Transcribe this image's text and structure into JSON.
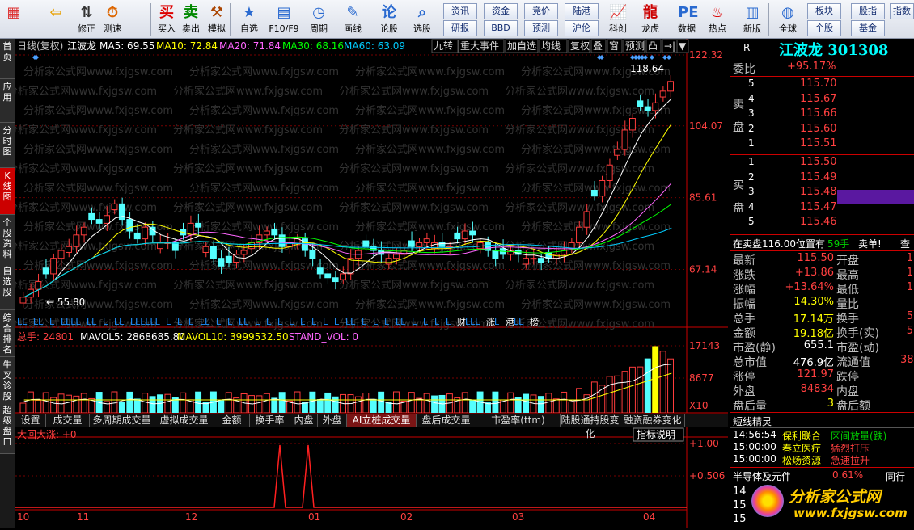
{
  "toolbar": {
    "buttons": [
      {
        "label": "",
        "icon": "windows-grid-icon"
      },
      {
        "label": "",
        "icon": "back-arrow-icon"
      },
      {
        "label": "修正",
        "icon": "arrow-up-down-icon"
      },
      {
        "label": "测速",
        "icon": "clock-icon"
      },
      {
        "label": "买入",
        "icon": "buy-icon",
        "glyph": "买"
      },
      {
        "label": "卖出",
        "icon": "sell-icon",
        "glyph": "卖"
      },
      {
        "label": "模拟",
        "icon": "hammer-icon"
      },
      {
        "label": "自选",
        "icon": "star-folder-icon"
      },
      {
        "label": "F10/F9",
        "icon": "f10-icon"
      },
      {
        "label": "周期",
        "icon": "clock-dial-icon"
      },
      {
        "label": "画线",
        "icon": "pencil-icon"
      },
      {
        "label": "论股",
        "icon": "discuss-icon"
      },
      {
        "label": "选股",
        "icon": "magnifier-chart-icon"
      },
      {
        "label": "科创",
        "icon": "kechuang-icon"
      },
      {
        "label": "龙虎",
        "icon": "dragon-icon"
      },
      {
        "label": "数据",
        "icon": "pe-icon"
      },
      {
        "label": "热点",
        "icon": "hot-icon"
      },
      {
        "label": "新版",
        "icon": "newversion-icon"
      },
      {
        "label": "全球",
        "icon": "globe-icon"
      }
    ],
    "mini_buttons": [
      "资讯",
      "资金",
      "竞价",
      "陆港",
      "研报",
      "BBD",
      "预测",
      "沪伦",
      "板块",
      "股指",
      "指数",
      "期货",
      "个股",
      "基金"
    ]
  },
  "sidebar": [
    "首页",
    "应用",
    "分时图",
    "K线图",
    "个股资料",
    "自选股",
    "综合排名",
    "牛叉诊股",
    "超级盘口"
  ],
  "chart_header": {
    "prefix": "日线(复权)",
    "stock": "江波龙",
    "ma5": "MA5: 69.55",
    "ma10": "MA10: 72.84",
    "ma20": "MA20: 71.84",
    "ma30": "MA30: 68.16",
    "ma60": "MA60: 63.09"
  },
  "chart_buttons": [
    "九转",
    "重大事件",
    "加自选",
    "均线",
    "复权",
    "叠",
    "窗",
    "预测",
    "凸",
    "→|",
    "▼"
  ],
  "price_axis": [
    "122.32",
    "104.07",
    "85.61",
    "67.14"
  ],
  "annotations": {
    "high": "118.64",
    "low": "55.80"
  },
  "markers": [
    "LL",
    "LL",
    "L",
    "LLLL",
    "LL",
    "L",
    "LL",
    "LLLLLL",
    "L",
    "L",
    "L",
    "LL",
    "L",
    "L",
    "LL",
    "L",
    "L",
    "L",
    "L",
    "L",
    "L",
    "L",
    "L",
    "LL",
    "L",
    "L",
    "L",
    "LL",
    "L",
    "L",
    "L",
    "L",
    "财",
    "LLL",
    "涨",
    "L",
    "港",
    "LL",
    "榜"
  ],
  "volume_header": {
    "total": "总手: 24801",
    "mavol5": "MAVOL5: 2868685.80",
    "mavol10": "MAVOL10: 3999532.50",
    "stand": "STAND_VOL: 0"
  },
  "volume_axis": [
    "17143",
    "8677",
    "X10"
  ],
  "tabs": [
    "设置",
    "成交量",
    "多周期成交量",
    "虚拟成交量",
    "金额",
    "换手率",
    "内盘",
    "外盘",
    "AI立桩成交量",
    "盘后成交量",
    "市盈率(ttm)",
    "陆股通持股变化",
    "融资融券变化"
  ],
  "indicator": {
    "label": "大回大涨: +0",
    "help": "指标说明",
    "axis": [
      "+1.00",
      "+0.506"
    ]
  },
  "months": [
    "10",
    "11",
    "12",
    "01",
    "02",
    "03",
    "04"
  ],
  "right": {
    "r": "R",
    "title": "江波龙 301308",
    "weibi_label": "委比",
    "weibi": "+95.17%",
    "sell_label": "卖盘",
    "buy_label": "买盘",
    "asks": [
      [
        "5",
        "115.70"
      ],
      [
        "4",
        "115.67"
      ],
      [
        "3",
        "115.66"
      ],
      [
        "2",
        "115.60"
      ],
      [
        "1",
        "115.51"
      ]
    ],
    "bids": [
      [
        "1",
        "115.50"
      ],
      [
        "2",
        "115.49"
      ],
      [
        "3",
        "115.48"
      ],
      [
        "4",
        "115.47"
      ],
      [
        "5",
        "115.46"
      ]
    ],
    "pending": "在卖盘116.00位置有",
    "pending_hands": "59手",
    "pending_action": "卖单!",
    "pending_more": "查",
    "stats": [
      [
        "最新",
        "115.50",
        "开盘",
        "1"
      ],
      [
        "涨跌",
        "+13.86",
        "最高",
        "1"
      ],
      [
        "涨幅",
        "+13.64%",
        "最低",
        "1"
      ],
      [
        "振幅",
        "14.30%",
        "量比",
        ""
      ],
      [
        "总手",
        "17.14万",
        "换手",
        "5"
      ],
      [
        "金额",
        "19.18亿",
        "换手(实)",
        "5"
      ],
      [
        "市盈(静)",
        "655.1",
        "市盈(动)",
        ""
      ],
      [
        "总市值",
        "476.9亿",
        "流通值",
        "38"
      ],
      [
        "涨停",
        "121.97",
        "跌停",
        ""
      ],
      [
        "外盘",
        "84834",
        "内盘",
        ""
      ],
      [
        "盘后量",
        "3",
        "盘后额",
        ""
      ]
    ],
    "sprite_title": "短线精灵",
    "sprite": [
      [
        "14:56:54",
        "保利联合",
        "区间放量(跌)"
      ],
      [
        "15:00:00",
        "春立医疗",
        "猛烈打压"
      ],
      [
        "15:00:00",
        "松炀资源",
        "急速拉升"
      ]
    ],
    "sector": "半导体及元件",
    "sector_pct": "0.61%",
    "sector_more": "同行",
    "nums": [
      "14",
      "15",
      "15"
    ],
    "brand": "分析家公式网",
    "brand_url": "www.fxjgsw.com"
  },
  "watermark": "分析家公式网www.fxjgsw.com",
  "chart_data": {
    "type": "candlestick",
    "price_range": [
      55.8,
      122.32
    ],
    "close_series": [
      60,
      62,
      64,
      66,
      70,
      72,
      73,
      76,
      78,
      80,
      79,
      81,
      84,
      80,
      77,
      75,
      78,
      76,
      74,
      74,
      72,
      76,
      79,
      78,
      73,
      70,
      68,
      69,
      71,
      72,
      74,
      76,
      77,
      76,
      73,
      74,
      75,
      72,
      70,
      66,
      65,
      64,
      66,
      70,
      72,
      73,
      72,
      71,
      70,
      71,
      72,
      73,
      74,
      75,
      74,
      73,
      73,
      75,
      77,
      76,
      74,
      72,
      70,
      71,
      72,
      71,
      70,
      70,
      69,
      70,
      71,
      72,
      74,
      78,
      82,
      86,
      90,
      94,
      98,
      103,
      106,
      109,
      108,
      110,
      113,
      115.5
    ],
    "high": 118.64,
    "low": 55.8
  }
}
